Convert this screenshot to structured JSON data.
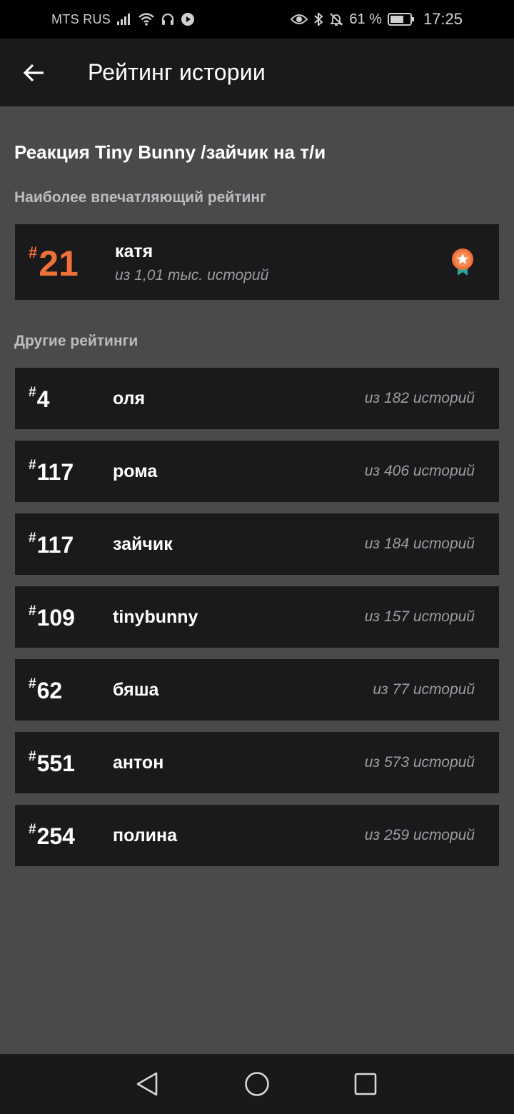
{
  "status_bar": {
    "carrier": "MTS RUS",
    "battery_percent": "61 %",
    "time": "17:25"
  },
  "app_bar": {
    "title": "Рейтинг истории"
  },
  "story": {
    "title": "Реакция Tiny Bunny /зайчик на т/и"
  },
  "top_rating": {
    "section_label": "Наиболее впечатляющий рейтинг",
    "hash": "#",
    "rank": "21",
    "name": "катя",
    "subtitle": "из 1,01 тыс. историй",
    "accent_color": "#f0703a",
    "badge_icon": "award-ribbon-icon"
  },
  "other_ratings": {
    "section_label": "Другие рейтинги",
    "items": [
      {
        "hash": "#",
        "rank": "4",
        "name": "оля",
        "count": "из 182 историй"
      },
      {
        "hash": "#",
        "rank": "117",
        "name": "рома",
        "count": "из 406 историй"
      },
      {
        "hash": "#",
        "rank": "117",
        "name": "зайчик",
        "count": "из 184 историй"
      },
      {
        "hash": "#",
        "rank": "109",
        "name": "tinybunny",
        "count": "из 157 историй"
      },
      {
        "hash": "#",
        "rank": "62",
        "name": "бяша",
        "count": "из 77 историй"
      },
      {
        "hash": "#",
        "rank": "551",
        "name": "антон",
        "count": "из 573 историй"
      },
      {
        "hash": "#",
        "rank": "254",
        "name": "полина",
        "count": "из 259 историй"
      }
    ]
  },
  "colors": {
    "background": "#4a494c",
    "card": "#1a191c",
    "accent": "#f0703a",
    "muted_text": "#9d9c9f"
  }
}
